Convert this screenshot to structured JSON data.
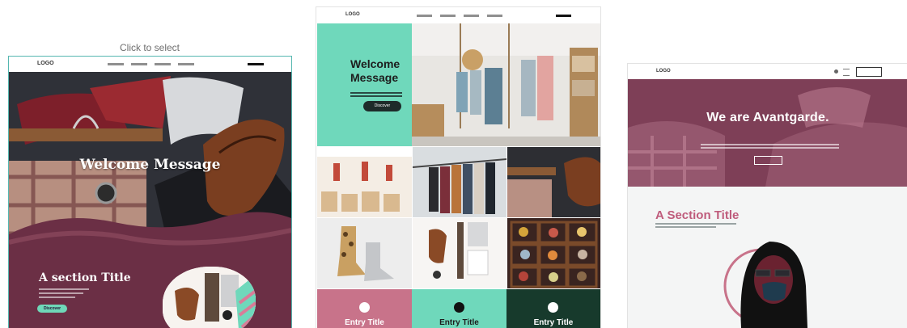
{
  "hint": "Click to select",
  "template1": {
    "logo": "LOGO",
    "hero_title": "Welcome Message",
    "section_title": "A section Title",
    "button": "Discover"
  },
  "template2": {
    "logo": "LOGO",
    "welcome_line1": "Welcome",
    "welcome_line2": "Message",
    "button": "Discover",
    "entries": [
      {
        "label": "Entry Title",
        "bg": "#c8738a",
        "dot": "#ffffff",
        "text": "#ffffff"
      },
      {
        "label": "Entry Title",
        "bg": "#6fd8bb",
        "dot": "#111111",
        "text": "#1d1d1d"
      },
      {
        "label": "Entry Title",
        "bg": "#173a2c",
        "dot": "#ffffff",
        "text": "#ffffff"
      }
    ]
  },
  "template3": {
    "logo": "LOGO",
    "hero_title": "We are Avantgarde.",
    "section_title": "A Section Title"
  },
  "colors": {
    "accent_teal": "#6fd8bb",
    "plum": "#6b2f45",
    "pink": "#c8738a",
    "selection_border": "#55b7b0"
  }
}
